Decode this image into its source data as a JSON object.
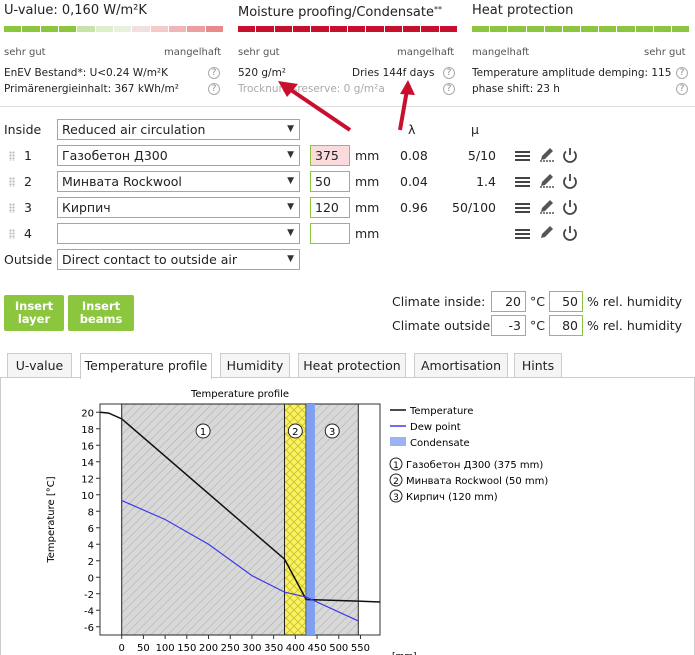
{
  "header": {
    "u_value": {
      "title": "U-value: 0,160 W/m²K",
      "good": "sehr gut",
      "bad": "mangelhaft",
      "line1": "EnEV Bestand*: U<0.24 W/m²K",
      "line2": "Primärenergieinhalt: 367 kWh/m²",
      "bar_colors": [
        "#8cc63f",
        "#8cc63f",
        "#8cc63f",
        "#8cc63f",
        "#c8e3a8",
        "#ddeecb",
        "#e8f0de",
        "#f0e0e0",
        "#f4c9c9",
        "#f0b5b5",
        "#ec9f9f",
        "#e88a8a"
      ]
    },
    "moisture": {
      "title": "Moisture proofing/Condensate",
      "sup": "**",
      "good": "sehr gut",
      "bad": "mangelhaft",
      "amount": "520 g/m²",
      "dries": "Dries 144f days",
      "reserve": "Trocknungsreserve: 0 g/m²a",
      "bar_colors": [
        "#c8102e",
        "#c8102e",
        "#c8102e",
        "#c8102e",
        "#c8102e",
        "#c8102e",
        "#c8102e",
        "#c8102e",
        "#c8102e",
        "#c8102e",
        "#c8102e",
        "#c8102e"
      ]
    },
    "heat": {
      "title": "Heat protection",
      "bad": "mangelhaft",
      "good": "sehr gut",
      "line1": "Temperature amplitude demping: 115",
      "line2": "phase shift: 23 h",
      "bar_colors": [
        "#8cc63f",
        "#8cc63f",
        "#8cc63f",
        "#8cc63f",
        "#8cc63f",
        "#8cc63f",
        "#8cc63f",
        "#8cc63f",
        "#8cc63f",
        "#8cc63f",
        "#8cc63f",
        "#8cc63f"
      ]
    }
  },
  "layers": {
    "inside_label": "Inside",
    "inside_value": "Reduced air circulation",
    "col_lambda": "λ",
    "col_mu": "μ",
    "unit": "mm",
    "rows": [
      {
        "num": "1",
        "material": "Газобетон Д300",
        "thickness": "375",
        "lambda": "0.08",
        "mu": "5/10"
      },
      {
        "num": "2",
        "material": "Минвата Rockwool",
        "thickness": "50",
        "lambda": "0.04",
        "mu": "1.4"
      },
      {
        "num": "3",
        "material": "Кирпич",
        "thickness": "120",
        "lambda": "0.96",
        "mu": "50/100"
      },
      {
        "num": "4",
        "material": "",
        "thickness": "",
        "lambda": "",
        "mu": ""
      }
    ],
    "outside_label": "Outside",
    "outside_value": "Direct contact to outside air"
  },
  "buttons": {
    "insert_layer": "Insert layer",
    "insert_beams": "Insert beams"
  },
  "climate": {
    "inside_label": "Climate inside:",
    "inside_temp": "20",
    "inside_hum": "50",
    "outside_label": "Climate outside:",
    "outside_temp": "-3",
    "outside_hum": "80",
    "temp_unit": "°C",
    "hum_unit": "% rel. humidity"
  },
  "tabs": [
    "U-value",
    "Temperature profile",
    "Humidity",
    "Heat protection",
    "Amortisation",
    "Hints"
  ],
  "chart_data": {
    "type": "line",
    "title": "Temperature profile",
    "ylabel": "Temperature [°C]",
    "xlabel": "[mm]",
    "xlim": [
      -50,
      595
    ],
    "ylim": [
      -7,
      21
    ],
    "xticks": [
      0,
      50,
      100,
      150,
      200,
      250,
      300,
      350,
      400,
      450,
      500,
      550
    ],
    "yticks": [
      20,
      18,
      16,
      14,
      12,
      10,
      8,
      6,
      4,
      2,
      0,
      -2,
      -4,
      -6
    ],
    "layers": [
      {
        "num": "1",
        "from": 0,
        "to": 375
      },
      {
        "num": "2",
        "from": 375,
        "to": 425
      },
      {
        "num": "3",
        "from": 425,
        "to": 545
      }
    ],
    "condensate_zone": [
      425,
      445
    ],
    "series": [
      {
        "name": "Temperature",
        "color": "#111111",
        "x": [
          -50,
          -30,
          0,
          375,
          425,
          545,
          595
        ],
        "y": [
          20,
          19.9,
          19.2,
          2.2,
          -2.7,
          -2.9,
          -3.0
        ]
      },
      {
        "name": "Dew point",
        "color": "#3a3ae8",
        "x": [
          0,
          100,
          200,
          300,
          375,
          425,
          545
        ],
        "y": [
          9.3,
          7.0,
          4.0,
          0.2,
          -1.8,
          -2.4,
          -5.3
        ]
      }
    ],
    "legend": [
      "Temperature",
      "Dew point",
      "Condensate"
    ],
    "layer_legend": [
      "Газобетон Д300 (375 mm)",
      "Минвата Rockwool (50 mm)",
      "Кирпич (120 mm)"
    ]
  }
}
